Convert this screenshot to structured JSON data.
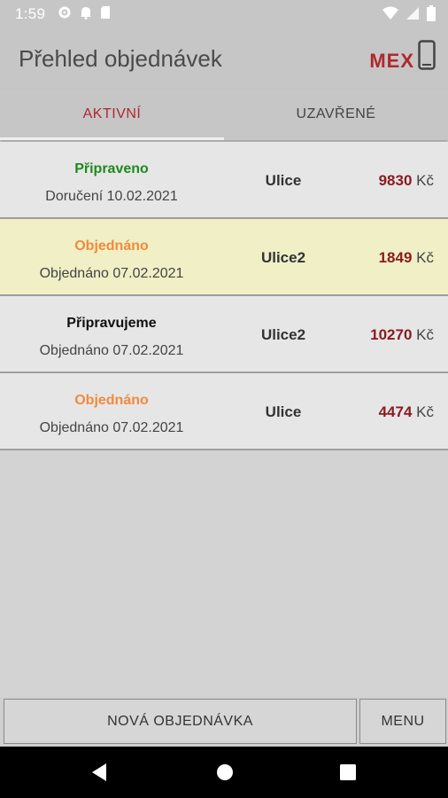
{
  "status_bar": {
    "time": "1:59",
    "left_icons": [
      "gear-icon",
      "notification-bell-icon",
      "sd-card-icon"
    ],
    "right_icons": [
      "wifi-icon",
      "cellular-signal-icon",
      "battery-icon"
    ]
  },
  "app_bar": {
    "title": "Přehled objednávek",
    "logo_text": "MEX"
  },
  "tabs": [
    {
      "label": "AKTIVNÍ",
      "active": true
    },
    {
      "label": "UZAVŘENÉ",
      "active": false
    }
  ],
  "orders": [
    {
      "status": "Připraveno",
      "status_color": "#1e8a1e",
      "date": "Doručení 10.02.2021",
      "street": "Ulice",
      "amount": "9830",
      "currency": "Kč",
      "highlight": false
    },
    {
      "status": "Objednáno",
      "status_color": "#f28a3c",
      "date": "Objednáno 07.02.2021",
      "street": "Ulice2",
      "amount": "1849",
      "currency": "Kč",
      "highlight": true
    },
    {
      "status": "Připravujeme",
      "status_color": "#111111",
      "date": "Objednáno 07.02.2021",
      "street": "Ulice2",
      "amount": "10270",
      "currency": "Kč",
      "highlight": false
    },
    {
      "status": "Objednáno",
      "status_color": "#f28a3c",
      "date": "Objednáno 07.02.2021",
      "street": "Ulice",
      "amount": "4474",
      "currency": "Kč",
      "highlight": false
    }
  ],
  "bottom_buttons": {
    "new_order": "NOVÁ OBJEDNÁVKA",
    "menu": "MENU"
  },
  "colors": {
    "accent": "#b0282c",
    "price": "#8b1b20",
    "highlight_row": "#f0efc6"
  },
  "nav_bar": {
    "icons": [
      "back-icon",
      "home-icon",
      "recents-icon"
    ]
  }
}
